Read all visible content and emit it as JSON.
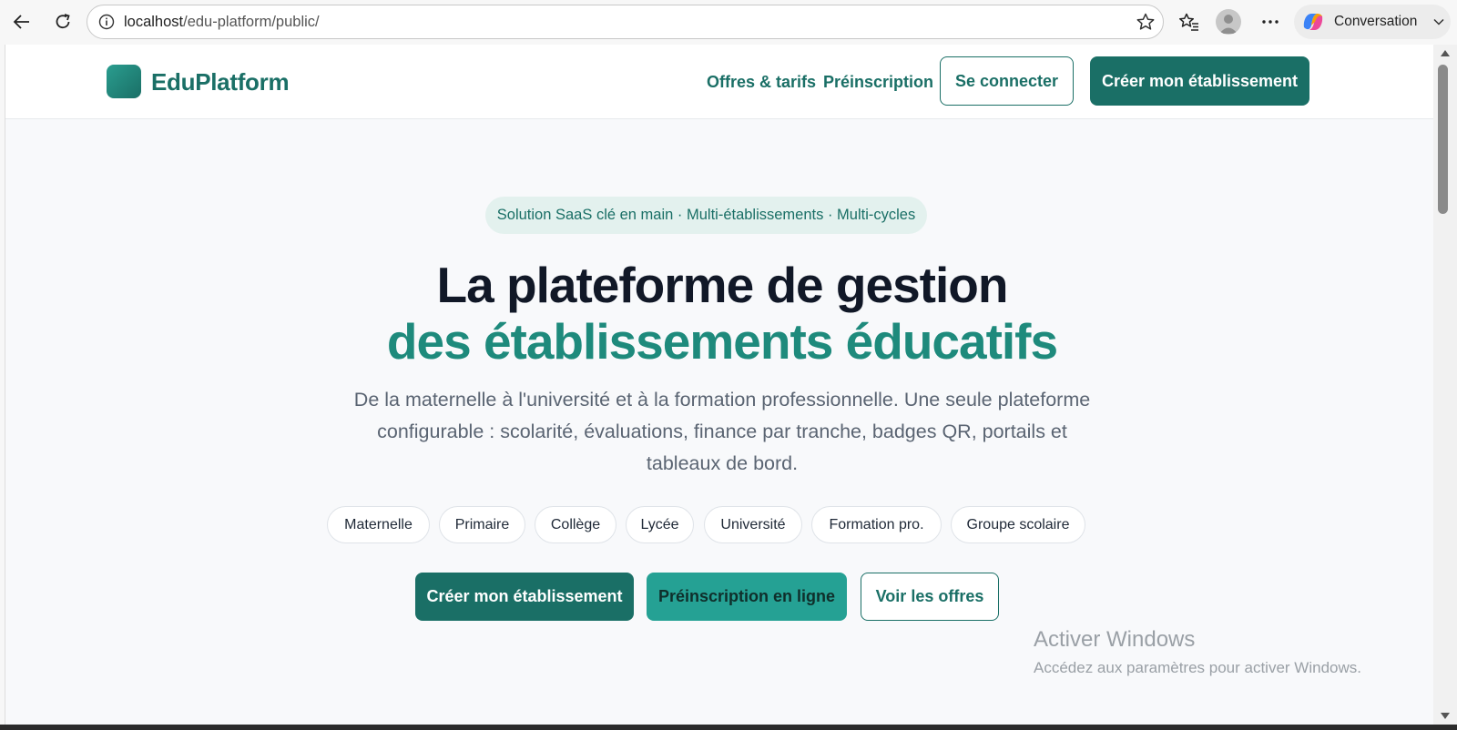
{
  "browser": {
    "url_host": "localhost",
    "url_path": "/edu-platform/public/",
    "copilot_label": "Conversation"
  },
  "site": {
    "brand": "EduPlatform",
    "nav": {
      "offers": "Offres & tarifs",
      "preregistration": "Préinscription",
      "login": "Se connecter",
      "create": "Créer mon établissement"
    }
  },
  "hero": {
    "pill": "Solution SaaS clé en main · Multi-établissements · Multi-cycles",
    "title_line1": "La plateforme de gestion",
    "title_line2": "des établissements éducatifs",
    "lead_line1": "De la maternelle à l'université et à la formation professionnelle. Une seule plateforme",
    "lead_line2": "configurable : scolarité, évaluations, finance par tranche, badges QR, portails et",
    "lead_line3": "tableaux de bord.",
    "chips": [
      "Maternelle",
      "Primaire",
      "Collège",
      "Lycée",
      "Université",
      "Formation pro.",
      "Groupe scolaire"
    ],
    "cta_primary": "Créer mon établissement",
    "cta_secondary": "Préinscription en ligne",
    "cta_outline": "Voir les offres"
  },
  "watermark": {
    "title": "Activer Windows",
    "subtitle": "Accédez aux paramètres pour activer Windows."
  },
  "colors": {
    "brand": "#1a6f66",
    "brand_light": "#25a194",
    "title_accent": "#1e8a7c",
    "pill_bg": "#e3f1ee"
  }
}
